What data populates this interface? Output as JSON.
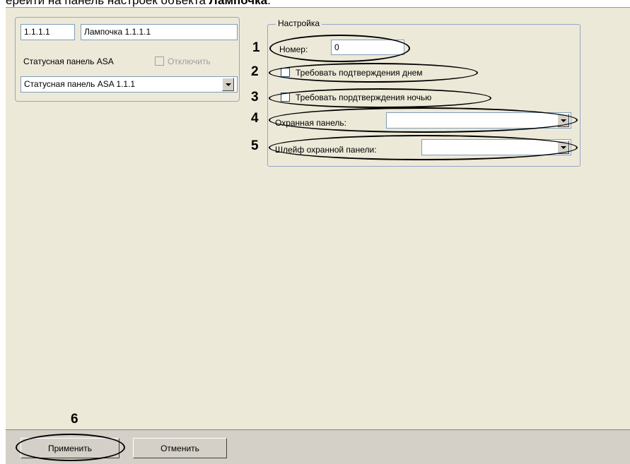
{
  "caption": {
    "text_prefix": "ерейти на панель настроек объекта ",
    "text_bold": "Лампочка",
    "text_suffix": "."
  },
  "object": {
    "id": "1.1.1.1",
    "name": "Лампочка 1.1.1.1",
    "parent_label": "Статусная панель ASA",
    "disable_label": "Отключить",
    "disable_checked": false,
    "parent_value": "Статусная панель ASA 1.1.1"
  },
  "settings": {
    "title": "Настройка",
    "number_label": "Номер:",
    "number_value": "0",
    "confirm_day_label": "Требовать подтверждения днем",
    "confirm_night_label": "Требовать пордтверждения ночью",
    "security_panel_label": "Охранная панель:",
    "security_panel_value": "",
    "loop_label": "Шлейф охранной панели:",
    "loop_value": ""
  },
  "annotations": [
    "1",
    "2",
    "3",
    "4",
    "5",
    "6"
  ],
  "buttons": {
    "apply": "Применить",
    "cancel": "Отменить"
  },
  "colors": {
    "dialog_bg": "#ece9d8",
    "button_bar_bg": "#d4d0c8",
    "field_border": "#7f9db9",
    "annotation_outline": "#000000"
  }
}
